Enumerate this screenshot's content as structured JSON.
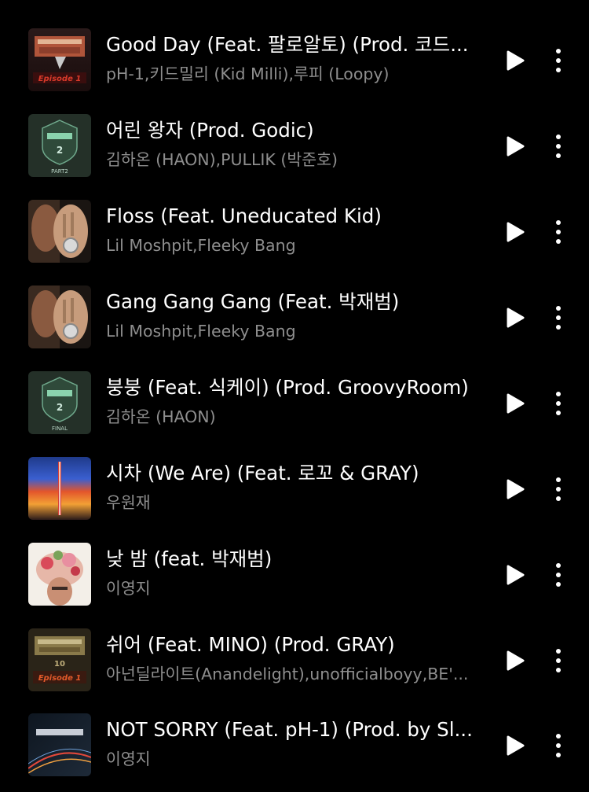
{
  "tracks": [
    {
      "title": "Good Day (Feat. 팔로알토) (Prod. 코드...",
      "artist": "pH-1,키드밀리 (Kid Milli),루피 (Loopy)",
      "art_text": "Episode 1",
      "art_icon": "show-me-the-money-7-cover"
    },
    {
      "title": "어린 왕자 (Prod. Godic)",
      "artist": "김하온 (HAON),PULLIK (박준호)",
      "art_text": "PART2",
      "art_icon": "high-school-rapper-2-cover"
    },
    {
      "title": "Floss (Feat. Uneducated Kid)",
      "artist": "Lil Moshpit,Fleeky Bang",
      "art_text": "",
      "art_icon": "portrait-hand-watch-cover"
    },
    {
      "title": "Gang Gang Gang (Feat. 박재범)",
      "artist": "Lil Moshpit,Fleeky Bang",
      "art_text": "",
      "art_icon": "portrait-hand-watch-cover"
    },
    {
      "title": "붕붕 (Feat. 식케이) (Prod. GroovyRoom)",
      "artist": "김하온 (HAON)",
      "art_text": "FINAL",
      "art_icon": "high-school-rapper-2-cover"
    },
    {
      "title": "시차 (We Are) (Feat. 로꼬 & GRAY)",
      "artist": "우원재",
      "art_text": "",
      "art_icon": "gradient-sunset-cover"
    },
    {
      "title": "낮 밤 (feat. 박재범)",
      "artist": "이영지",
      "art_text": "",
      "art_icon": "flower-portrait-cover"
    },
    {
      "title": "쉬어 (Feat. MINO) (Prod. GRAY)",
      "artist": "아넌딜라이트(Anandelight),unofficialboyy,BE'...",
      "art_text": "Episode 1",
      "art_icon": "show-me-the-money-10-cover"
    },
    {
      "title": "NOT SORRY (Feat. pH-1) (Prod. by Sl...",
      "artist": "이영지",
      "art_text": "",
      "art_icon": "show-me-the-money-11-cover"
    }
  ],
  "colors": {
    "background": "#000000",
    "title": "#ffffff",
    "artist": "#8e8e8e"
  }
}
